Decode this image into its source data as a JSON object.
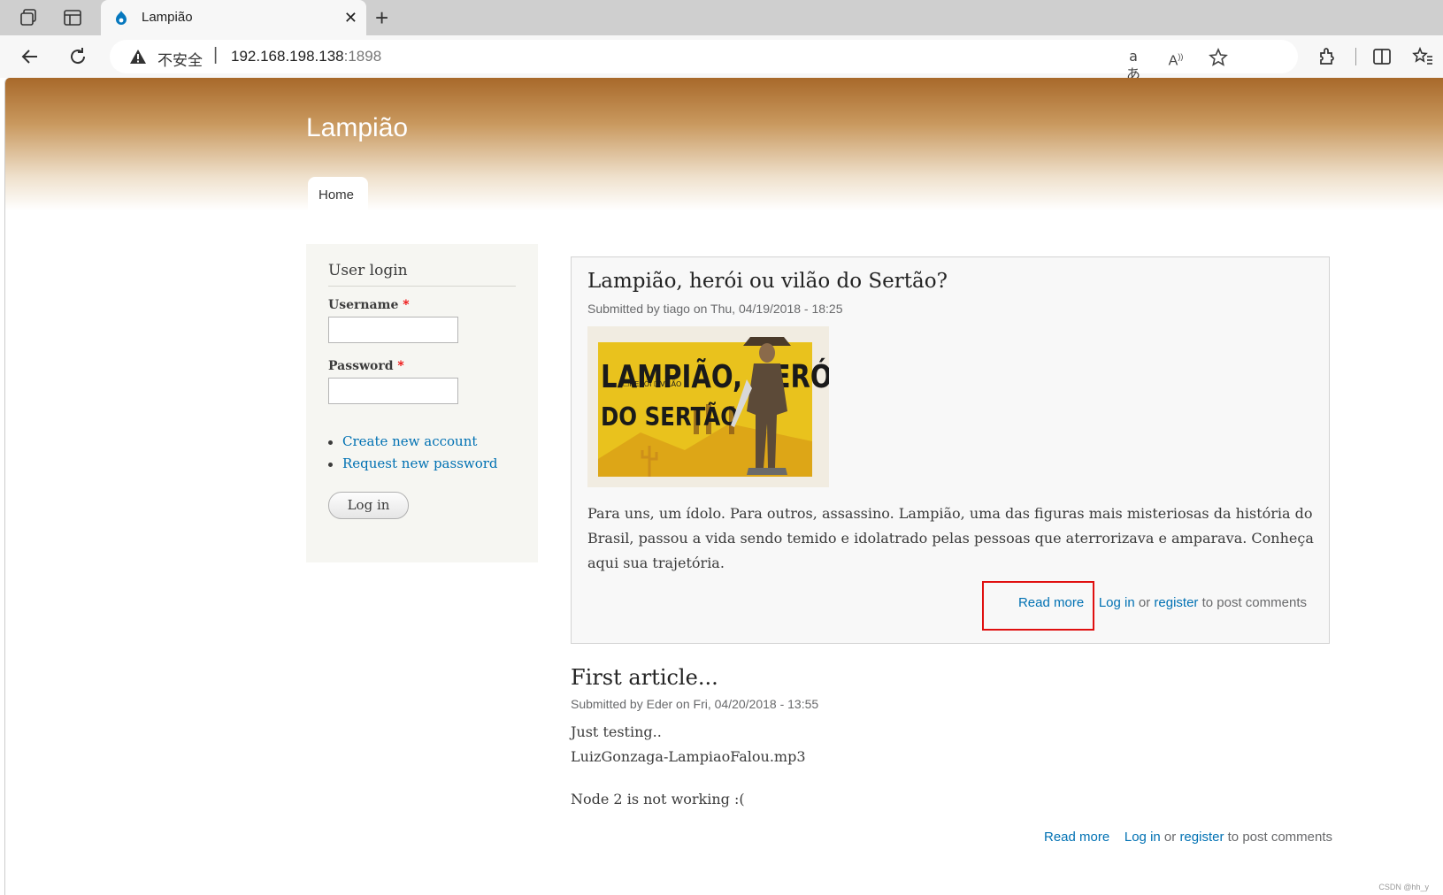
{
  "browser": {
    "tab_title": "Lampião",
    "insecure_label": "不安全",
    "url_host": "192.168.198.138",
    "url_port": ":1898"
  },
  "site": {
    "name": "Lampião",
    "nav": {
      "home": "Home"
    }
  },
  "login": {
    "title": "User login",
    "username_label": "Username",
    "password_label": "Password",
    "required_mark": "*",
    "username_value": "",
    "password_value": "",
    "create_account": "Create new account",
    "request_password": "Request new password",
    "submit": "Log in"
  },
  "articles": [
    {
      "title": "Lampião, herói ou vilão do Sertão?",
      "submitted": "Submitted by tiago on Thu, 04/19/2018 - 18:25",
      "image_text": "LAMPIÃO, HERÓI VILÃO DO SERTÃO",
      "body_lines": [
        "Para uns, um ídolo. Para outros, assassino. Lampião, uma das figuras mais misteriosas da história do",
        "Brasil, passou a vida sendo temido e idolatrado pelas pessoas que aterrorizava e amparava. Conheça",
        "aqui sua trajetória."
      ],
      "read_more": "Read more",
      "login_link": "Log in",
      "or_text": "or",
      "register_link": "register",
      "post_comments": "to post comments"
    },
    {
      "title": "First article...",
      "submitted": "Submitted by Eder on Fri, 04/20/2018 - 13:55",
      "body_lines": [
        "Just testing..",
        "LuizGonzaga-LampiaoFalou.mp3",
        "Node 2 is not working :("
      ],
      "read_more": "Read more",
      "login_link": "Log in",
      "or_text": "or",
      "register_link": "register",
      "post_comments": "to post comments"
    }
  ],
  "watermark": "CSDN @hh_y",
  "colors": {
    "header_top": "#a8692a",
    "link": "#0071b3",
    "highlight": "#e01010"
  }
}
